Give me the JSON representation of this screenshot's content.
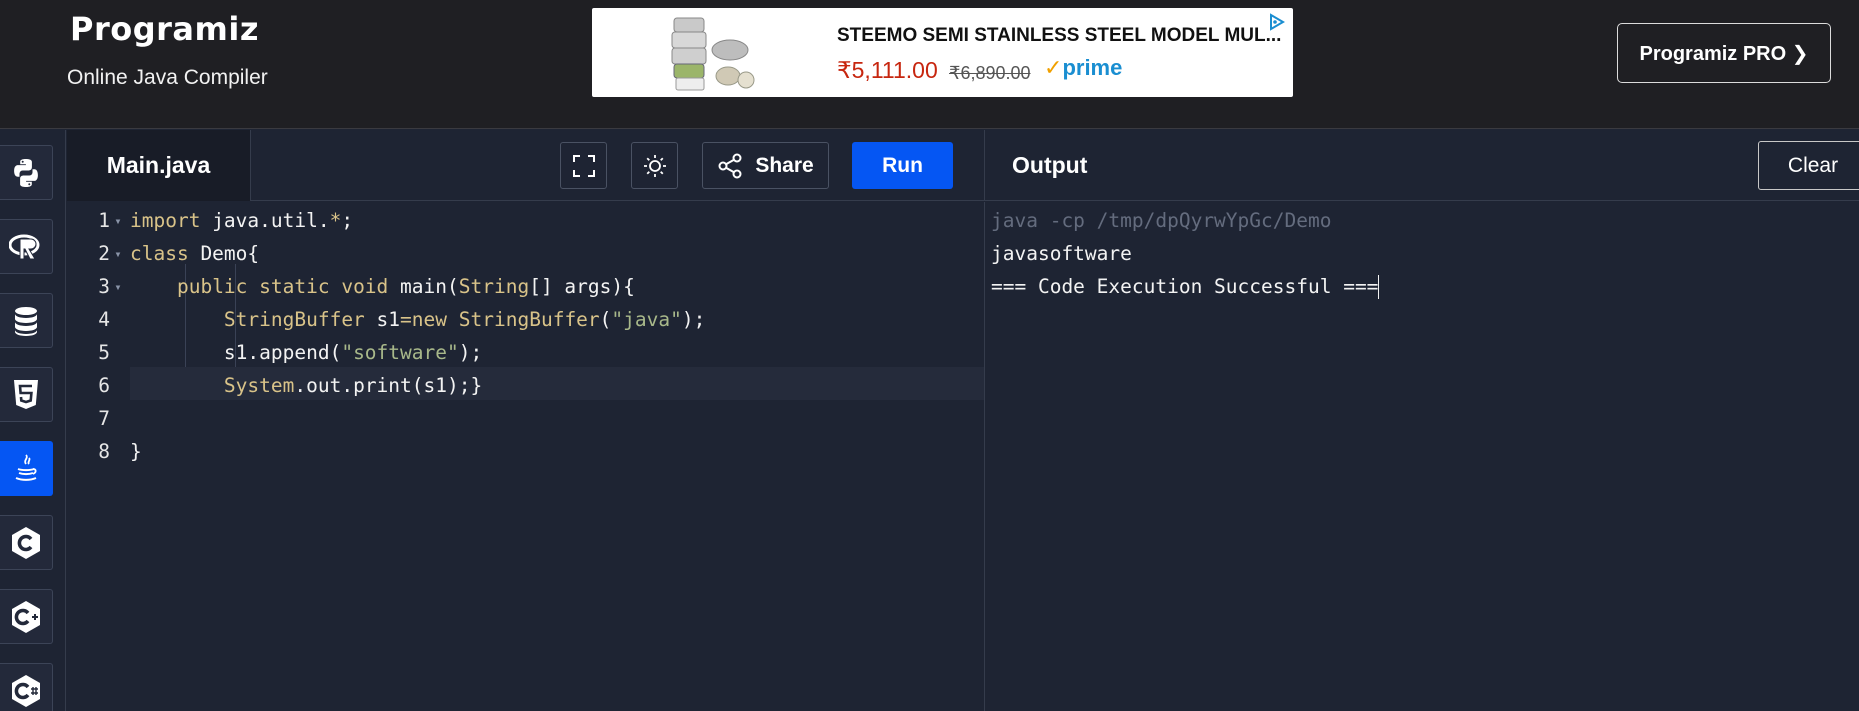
{
  "header": {
    "logo": "Programiz",
    "subtitle": "Online Java Compiler",
    "pro_button": "Programiz PRO ❯"
  },
  "ad": {
    "title": "STEEMO SEMI STAINLESS STEEL MODEL MUL...",
    "price": "₹5,111.00",
    "old_price": "₹6,890.00",
    "prime_label": "prime"
  },
  "sidebar": {
    "items": [
      {
        "name": "python"
      },
      {
        "name": "r"
      },
      {
        "name": "sql"
      },
      {
        "name": "html5"
      },
      {
        "name": "java",
        "active": true
      },
      {
        "name": "c"
      },
      {
        "name": "cpp"
      },
      {
        "name": "csharp"
      }
    ]
  },
  "editor": {
    "file_tab": "Main.java",
    "share_label": "Share",
    "run_label": "Run",
    "lines": [
      {
        "num": "1",
        "fold": "▾"
      },
      {
        "num": "2",
        "fold": "▾"
      },
      {
        "num": "3",
        "fold": "▾"
      },
      {
        "num": "4",
        "fold": ""
      },
      {
        "num": "5",
        "fold": ""
      },
      {
        "num": "6",
        "fold": ""
      },
      {
        "num": "7",
        "fold": ""
      },
      {
        "num": "8",
        "fold": ""
      }
    ],
    "code": {
      "l1_kw": "import",
      "l1_rest": " java.util.",
      "l1_star": "*",
      "l1_end": ";",
      "l2_kw": "class",
      "l2_rest": " Demo{",
      "l3_kw": "public static void",
      "l3_mid": " main(",
      "l3_type": "String",
      "l3_end": "[] args){",
      "l4_type": "StringBuffer",
      "l4_mid": " s1",
      "l4_eq": "=",
      "l4_new": "new",
      "l4_sp": " ",
      "l4_type2": "StringBuffer",
      "l4_open": "(",
      "l4_str": "\"java\"",
      "l4_end": ");",
      "l5_pre": "s1.append(",
      "l5_str": "\"software\"",
      "l5_end": ");",
      "l6_type": "System",
      "l6_rest": ".out.print(s1);}",
      "l8": "}"
    }
  },
  "output": {
    "title": "Output",
    "clear_label": "Clear",
    "lines": [
      "java -cp /tmp/dpQyrwYpGc/Demo",
      "javasoftware",
      "=== Code Execution Successful ==="
    ]
  },
  "colors": {
    "accent": "#0556f3",
    "background": "#1e2433",
    "topbar": "#1f1f23",
    "keyword": "#d9c389",
    "string": "#a8b88a"
  }
}
